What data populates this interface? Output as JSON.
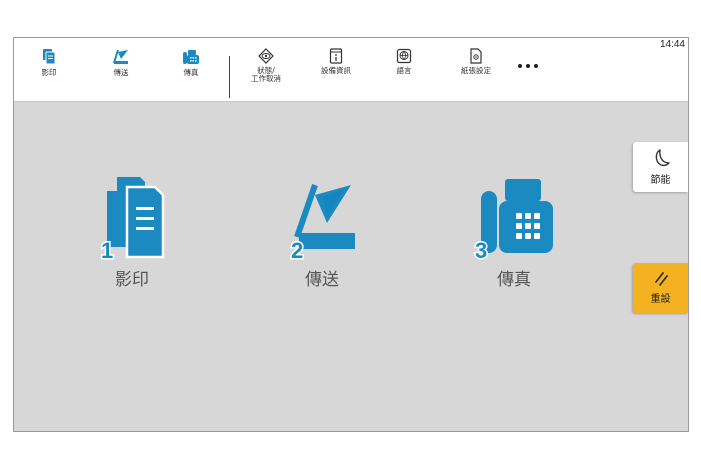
{
  "status": {
    "time": "14:44"
  },
  "toolbar": {
    "copy": {
      "label": "影印",
      "icon": "copy-icon"
    },
    "send": {
      "label": "傳送",
      "icon": "send-icon"
    },
    "fax": {
      "label": "傳真",
      "icon": "fax-icon"
    },
    "job_status": {
      "label_line1": "狀態/",
      "label_line2": "工作取消",
      "icon": "eye-icon"
    },
    "device_info": {
      "label": "設備資訊",
      "icon": "info-icon"
    },
    "language": {
      "label": "語言",
      "icon": "globe-icon"
    },
    "paper_settings": {
      "label": "紙張設定",
      "icon": "paper-icon"
    },
    "more": {
      "icon": "more-icon"
    }
  },
  "apps": [
    {
      "number": "1",
      "label": "影印",
      "icon": "copy-icon"
    },
    {
      "number": "2",
      "label": "傳送",
      "icon": "send-icon"
    },
    {
      "number": "3",
      "label": "傳真",
      "icon": "fax-icon"
    }
  ],
  "side": {
    "energy_saver": {
      "label": "節能",
      "icon": "moon-icon"
    },
    "reset": {
      "label": "重設",
      "icon": "reset-icon"
    }
  },
  "colors": {
    "accent": "#1a8ac0",
    "reset": "#f4b223",
    "background": "#d7d7d7"
  }
}
